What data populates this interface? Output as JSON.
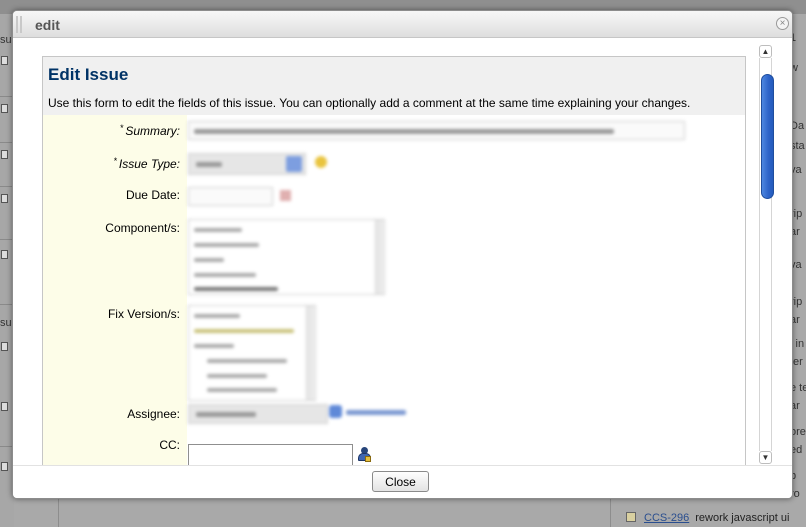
{
  "background": {
    "left_edge": [
      {
        "text": "su"
      },
      {
        "text": "su"
      }
    ],
    "right_edge": [
      {
        "text": "1"
      },
      {
        "text": "w"
      },
      {
        "text": "Da"
      },
      {
        "text": "sta"
      },
      {
        "text": "va"
      },
      {
        "text": "rip"
      },
      {
        "text": "ar"
      },
      {
        "text": "va"
      },
      {
        "text": "rip"
      },
      {
        "text": "ar"
      },
      {
        "text": "l in"
      },
      {
        "text": "ter"
      },
      {
        "text": "e te"
      },
      {
        "text": "ar"
      },
      {
        "text": "ore"
      },
      {
        "text": "ed"
      },
      {
        "text": "b"
      },
      {
        "text": "ro"
      }
    ],
    "bottom_issue": {
      "key": "CCS-296",
      "summary": "rework javascript ui"
    }
  },
  "dialog": {
    "title": "edit",
    "close_icon": "close-icon",
    "heading": "Edit Issue",
    "description": "Use this form to edit the fields of this issue. You can optionally add a comment at the same time explaining your changes.",
    "fields": {
      "summary": {
        "label": "Summary:",
        "required": true,
        "required_mark": "*"
      },
      "issue_type": {
        "label": "Issue Type:",
        "required": true,
        "required_mark": "*"
      },
      "due_date": {
        "label": "Due Date:"
      },
      "components": {
        "label": "Component/s:"
      },
      "fix_versions": {
        "label": "Fix Version/s:"
      },
      "assignee": {
        "label": "Assignee:"
      },
      "cc": {
        "label": "CC:",
        "value": ""
      }
    },
    "footer": {
      "close_label": "Close"
    }
  },
  "colors": {
    "heading": "#003366",
    "label_column": "#fdfde8",
    "header_band": "#f0f0f0",
    "scroll_thumb": "#2d63c8"
  }
}
